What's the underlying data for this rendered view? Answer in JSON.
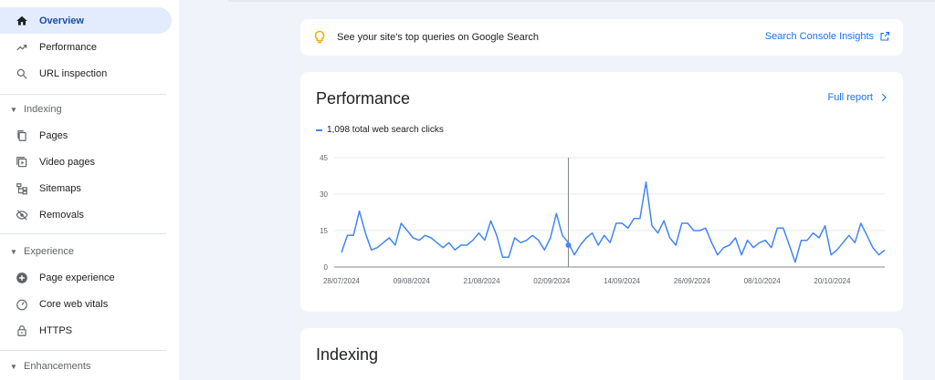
{
  "sidebar": {
    "top_items": [
      {
        "label": "Overview",
        "icon": "home-icon",
        "active": true
      },
      {
        "label": "Performance",
        "icon": "trending-up-icon"
      },
      {
        "label": "URL inspection",
        "icon": "search-icon"
      }
    ],
    "sections": [
      {
        "title": "Indexing",
        "items": [
          {
            "label": "Pages",
            "icon": "pages-icon"
          },
          {
            "label": "Video pages",
            "icon": "video-pages-icon"
          },
          {
            "label": "Sitemaps",
            "icon": "sitemap-icon"
          },
          {
            "label": "Removals",
            "icon": "eye-off-icon"
          }
        ]
      },
      {
        "title": "Experience",
        "items": [
          {
            "label": "Page experience",
            "icon": "plus-circle-icon"
          },
          {
            "label": "Core web vitals",
            "icon": "gauge-icon"
          },
          {
            "label": "HTTPS",
            "icon": "lock-icon"
          }
        ]
      },
      {
        "title": "Enhancements",
        "items": []
      }
    ]
  },
  "insights": {
    "message": "See your site's top queries on Google Search",
    "link_label": "Search Console Insights",
    "accent": "#f9ab00"
  },
  "performance": {
    "title": "Performance",
    "full_report_label": "Full report",
    "legend_label": "1,098 total web search clicks",
    "line_color": "#4285f4"
  },
  "indexing": {
    "title": "Indexing"
  },
  "chart_data": {
    "type": "line",
    "title": "",
    "xlabel": "",
    "ylabel": "",
    "ylim": [
      0,
      45
    ],
    "yticks": [
      0,
      15,
      30,
      45
    ],
    "xlim": [
      "2024-07-28",
      "2024-10-29"
    ],
    "xtick_labels": [
      "28/07/2024",
      "09/08/2024",
      "21/08/2024",
      "02/09/2024",
      "14/09/2024",
      "26/09/2024",
      "08/10/2024",
      "20/10/2024"
    ],
    "grid": true,
    "series": [
      {
        "name": "1,098 total web search clicks",
        "values": [
          6,
          13,
          13,
          23,
          14,
          7,
          8,
          10,
          12,
          9,
          18,
          15,
          12,
          11,
          13,
          12,
          10,
          8,
          10,
          7,
          9,
          9,
          11,
          14,
          11,
          19,
          13,
          4,
          4,
          12,
          10,
          11,
          13,
          11,
          7,
          12,
          22,
          13,
          10,
          5,
          9,
          12,
          14,
          9,
          13,
          10,
          18,
          18,
          16,
          20,
          20,
          35,
          17,
          14,
          19,
          12,
          9,
          18,
          18,
          15,
          15,
          16,
          10,
          5,
          8,
          9,
          12,
          5,
          11,
          8,
          10,
          11,
          8,
          16,
          16,
          9,
          2,
          11,
          11,
          14,
          12,
          17,
          5,
          7,
          10,
          13,
          10,
          18,
          13,
          8,
          5,
          7
        ]
      }
    ],
    "marker_point": {
      "label": "02/09/2024",
      "index": 38,
      "value": 9
    }
  }
}
